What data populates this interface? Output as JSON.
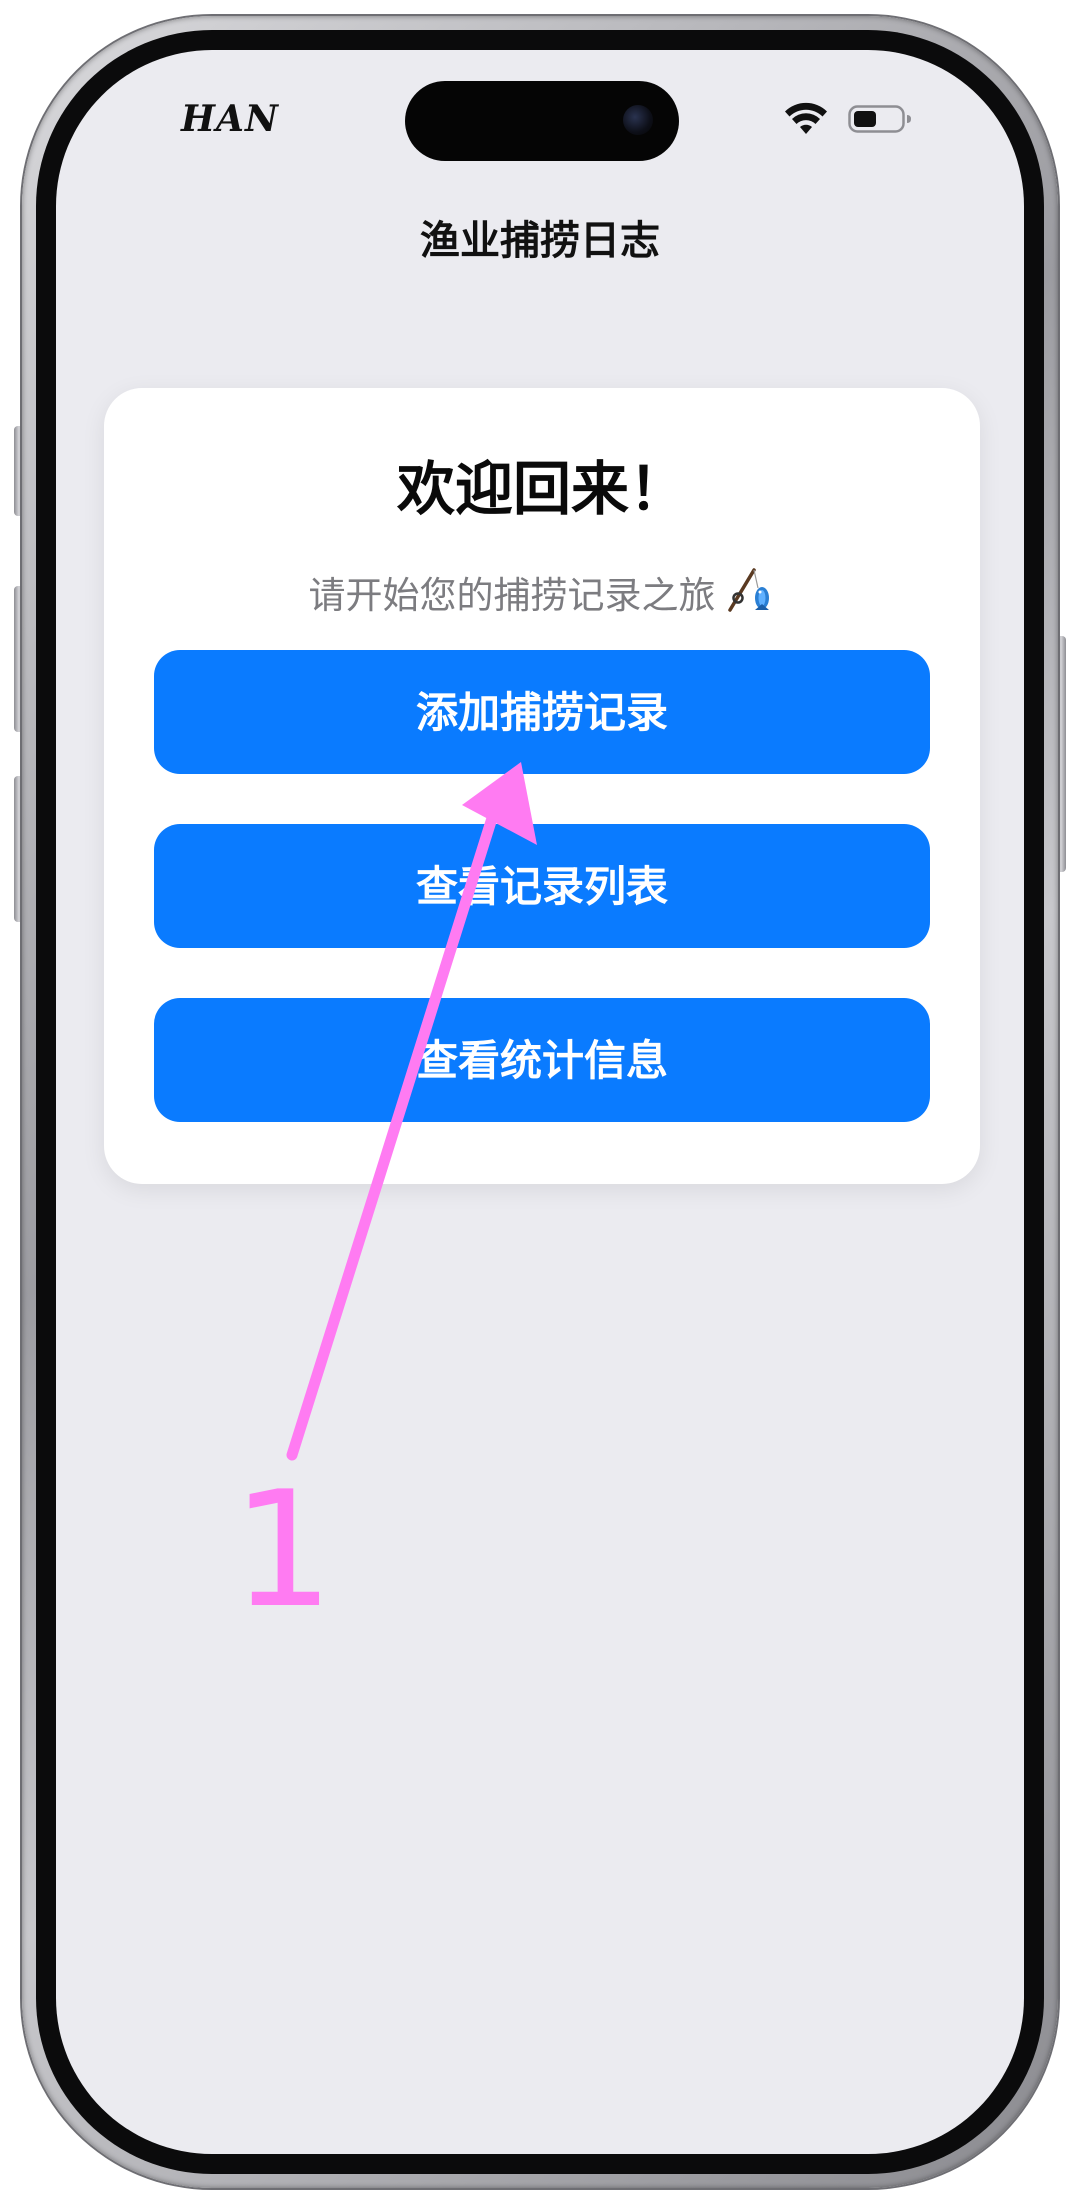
{
  "status_bar": {
    "carrier": "HAN",
    "wifi_icon": "wifi-icon",
    "battery_icon": "battery-icon"
  },
  "nav": {
    "title": "渔业捕捞日志"
  },
  "welcome_card": {
    "title": "欢迎回来！",
    "subtitle": "请开始您的捕捞记录之旅",
    "subtitle_icon": "fishing-pole-icon"
  },
  "actions": [
    {
      "label": "添加捕捞记录"
    },
    {
      "label": "查看记录列表"
    },
    {
      "label": "查看统计信息"
    }
  ],
  "annotation": {
    "label": "1",
    "color": "#ff7bf2",
    "target": "添加捕捞记录"
  },
  "colors": {
    "accent": "#0a7bff",
    "background": "#ebebf0",
    "card": "#ffffff",
    "annotation": "#ff7bf2"
  }
}
